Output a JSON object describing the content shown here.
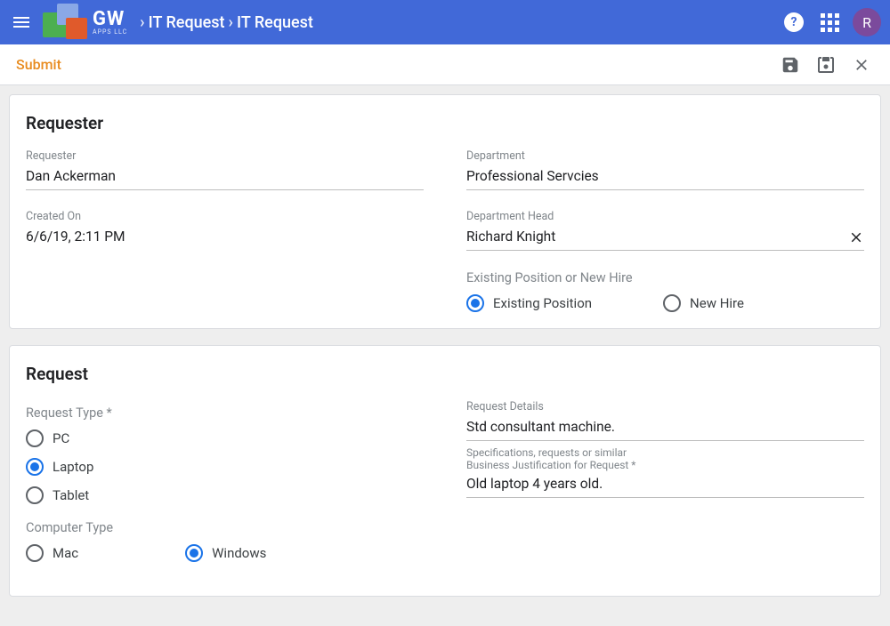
{
  "header": {
    "brand_top": "GW",
    "brand_sub": "APPS LLC",
    "breadcrumb": [
      "IT Request",
      "IT Request"
    ],
    "avatar_initial": "R"
  },
  "subbar": {
    "submit_label": "Submit"
  },
  "requester_card": {
    "title": "Requester",
    "fields": {
      "requester_label": "Requester",
      "requester_value": "Dan Ackerman",
      "created_label": "Created On",
      "created_value": "6/6/19, 2:11 PM",
      "department_label": "Department",
      "department_value": "Professional Servcies",
      "dept_head_label": "Department Head",
      "dept_head_value": "Richard Knight",
      "position_label": "Existing Position or New Hire",
      "position_options": {
        "existing": "Existing Position",
        "new_hire": "New Hire"
      },
      "position_selected": "existing"
    }
  },
  "request_card": {
    "title": "Request",
    "request_type": {
      "label": "Request Type *",
      "options": {
        "pc": "PC",
        "laptop": "Laptop",
        "tablet": "Tablet"
      },
      "selected": "laptop"
    },
    "computer_type": {
      "label": "Computer Type",
      "options": {
        "mac": "Mac",
        "windows": "Windows"
      },
      "selected": "windows"
    },
    "details": {
      "label": "Request Details",
      "value": "Std consultant machine.",
      "helper": "Specifications, requests or similar"
    },
    "justification": {
      "label": "Business Justification for Request *",
      "value": "Old laptop 4 years old."
    }
  }
}
